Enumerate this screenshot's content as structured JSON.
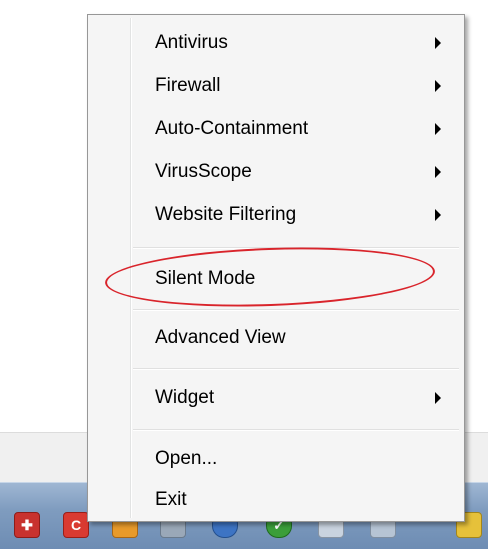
{
  "menu": {
    "items": [
      {
        "label": "Antivirus",
        "submenu": true
      },
      {
        "label": "Firewall",
        "submenu": true
      },
      {
        "label": "Auto-Containment",
        "submenu": true
      },
      {
        "label": "VirusScope",
        "submenu": true
      },
      {
        "label": "Website Filtering",
        "submenu": true
      },
      {
        "label": "Silent Mode",
        "submenu": false,
        "highlighted": true
      },
      {
        "label": "Advanced View",
        "submenu": false
      },
      {
        "label": "Widget",
        "submenu": true
      },
      {
        "label": "Open...",
        "submenu": false
      },
      {
        "label": "Exit",
        "submenu": false
      }
    ]
  },
  "annotation": {
    "color": "#d9242b",
    "target": "Silent Mode"
  },
  "taskbar": {
    "tray_icons": [
      "security-shield-icon",
      "comodo-icon",
      "orange-app-icon",
      "network-icon",
      "globe-icon",
      "check-shield-icon",
      "speaker-icon",
      "monitor-icon",
      "action-center-flag-icon"
    ]
  }
}
